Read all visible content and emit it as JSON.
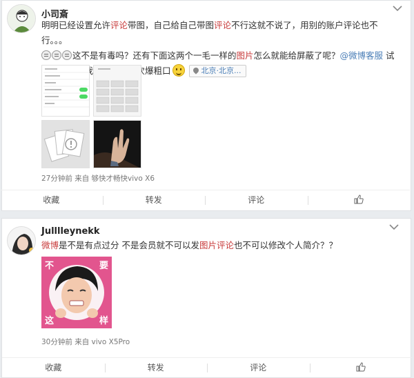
{
  "posts": [
    {
      "username": "小司斎",
      "text": {
        "p1": "明明已经设置允许",
        "kw1": "评论",
        "p2": "带图，自己给自己带图",
        "kw2": "评论",
        "p3": "不行这就不说了，用别的账户评论也不行。。。",
        "p4": "这不是有毒吗？还有下面这两个一毛一样的",
        "kw3": "图片",
        "p5": "怎么就能给屏蔽了呢？",
        "mention": "@微博客服",
        "p6": "试了老半天，我忍住了一万次爆粗口"
      },
      "location": "北京·北京...",
      "meta": "27分钟前 来自 够快才畅快vivo X6",
      "actions": {
        "favorite": "收藏",
        "repost": "转发",
        "comment": "评论"
      },
      "icons": {
        "avatar": "avatar-icon",
        "menu": "chevron-down-icon",
        "emoji": "grimace-emoji-icon",
        "smile": "smile-emoji-icon",
        "location": "location-pin-icon",
        "like": "thumbs-up-icon"
      }
    },
    {
      "username": "Julllleynekk",
      "text": {
        "kw1": "微博",
        "p1": "是不是有点过分 不是会员就不可以发",
        "kw2": "图片评论",
        "p2": "也不可以修改个人简介？？"
      },
      "sticker": {
        "tl": "不",
        "tr": "要",
        "bl": "这",
        "br": "样"
      },
      "meta": "30分钟前 来自 vivo X5Pro",
      "actions": {
        "favorite": "收藏",
        "repost": "转发",
        "comment": "评论"
      }
    }
  ],
  "colors": {
    "accent_red": "#c83c3c",
    "link_blue": "#4a7eb7",
    "sticker_pink": "#e2558e"
  }
}
